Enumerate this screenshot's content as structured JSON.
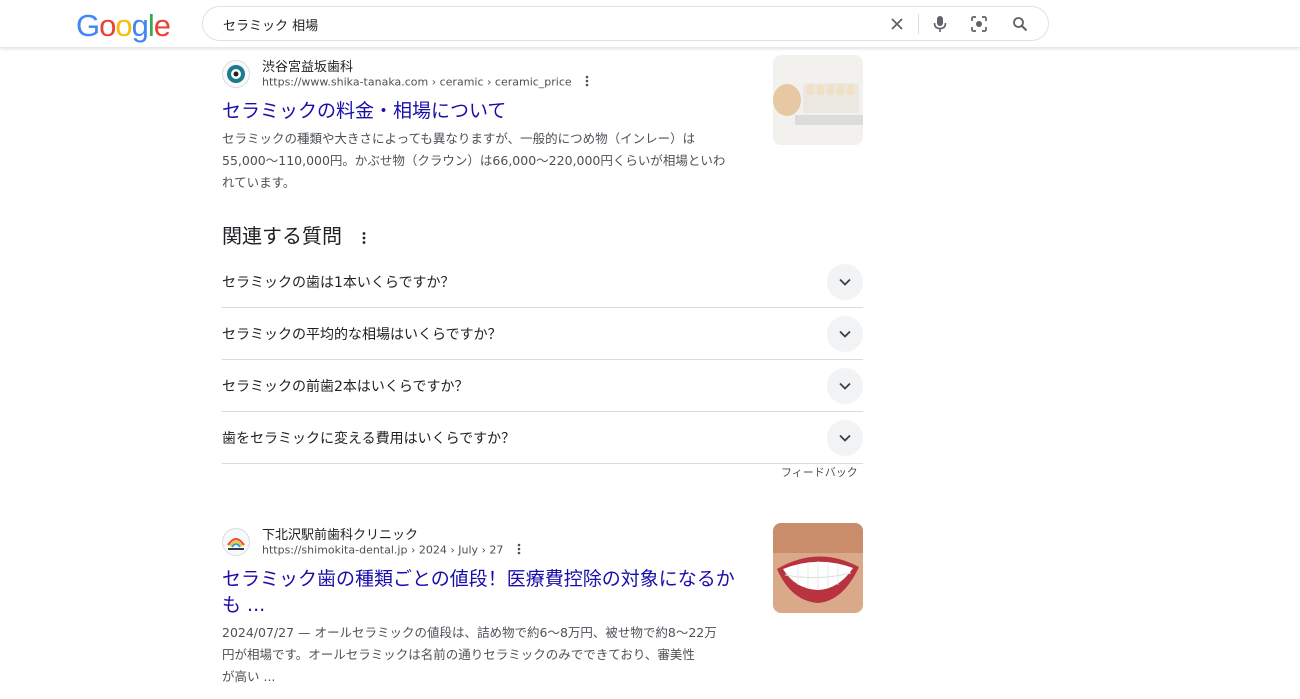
{
  "header": {
    "logo_letters": [
      {
        "ch": "G",
        "color": "#4285F4"
      },
      {
        "ch": "o",
        "color": "#EA4335"
      },
      {
        "ch": "o",
        "color": "#FBBC05"
      },
      {
        "ch": "g",
        "color": "#4285F4"
      },
      {
        "ch": "l",
        "color": "#34A853"
      },
      {
        "ch": "e",
        "color": "#EA4335"
      }
    ],
    "search_query": "セラミック 相場",
    "icons": [
      "clear-icon",
      "microphone-icon",
      "lens-icon",
      "search-icon"
    ]
  },
  "results": [
    {
      "site_name": "渋谷宮益坂歯科",
      "url": "https://www.shika-tanaka.com › ceramic › ceramic_price",
      "title": "セラミックの料金・相場について",
      "snippet_lines": [
        "セラミックの種類や大きさによっても異なりますが、一般的につめ物（インレー）は",
        "55,000〜110,000円。かぶせ物（クラウン）は66,000〜220,000円くらいが相場といわ",
        "れています。"
      ]
    },
    {
      "site_name": "下北沢駅前歯科クリニック",
      "url": "https://shimokita-dental.jp › 2024 › July › 27",
      "title_lines": [
        "セラミック歯の種類ごとの値段！医療費控除の対象になるか",
        "も ..."
      ],
      "snippet_lines": [
        "2024/07/27 — オールセラミックの値段は、詰め物で約6〜8万円、被せ物で約8〜22万",
        "円が相場です。オールセラミックは名前の通りセラミックのみでできており、審美性",
        "が高い ..."
      ]
    }
  ],
  "paa": {
    "title": "関連する質問",
    "questions": [
      "セラミックの歯は1本いくらですか？",
      "セラミックの平均的な相場はいくらですか？",
      "セラミックの前歯2本はいくらですか？",
      "歯をセラミックに変える費用はいくらですか？"
    ],
    "feedback": "フィードバック"
  },
  "colors": {
    "link": "#1a0dab",
    "text": "#202124",
    "muted": "#4d5156"
  }
}
